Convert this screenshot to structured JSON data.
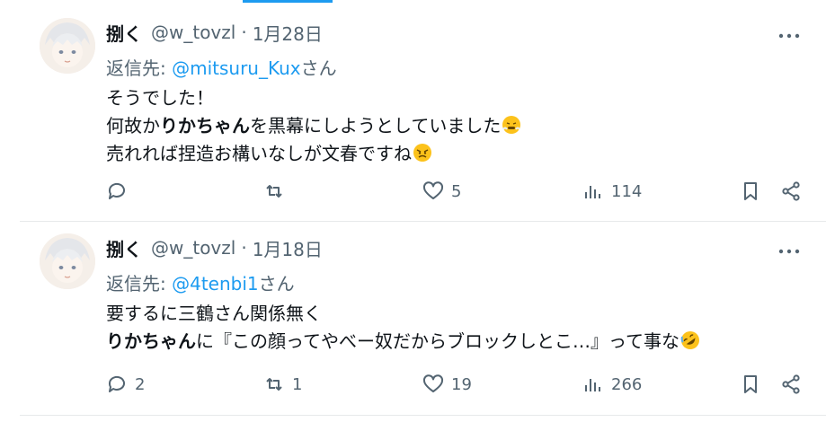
{
  "posts": [
    {
      "author": {
        "name": "捌く",
        "handle": "@w_tovzl",
        "date": "1月28日"
      },
      "reply_to": {
        "prefix": "返信先: ",
        "mention": "@mitsuru_Kux",
        "suffix": "さん"
      },
      "lines": [
        {
          "segments": [
            {
              "text": "そうでした！",
              "bold": false
            }
          ]
        },
        {
          "segments": [
            {
              "text": "何故か",
              "bold": false
            },
            {
              "text": "りかちゃん",
              "bold": true
            },
            {
              "text": "を黒幕にしようとしていました",
              "bold": false
            }
          ],
          "emoji": "triumph-face"
        },
        {
          "segments": [
            {
              "text": "売れれば捏造お構いなしが文春ですね",
              "bold": false
            }
          ],
          "emoji": "angry-face"
        }
      ],
      "stats": {
        "replies": "",
        "reposts": "",
        "likes": "5",
        "views": "114"
      }
    },
    {
      "author": {
        "name": "捌く",
        "handle": "@w_tovzl",
        "date": "1月18日"
      },
      "reply_to": {
        "prefix": "返信先: ",
        "mention": "@4tenbi1",
        "suffix": "さん"
      },
      "lines": [
        {
          "segments": [
            {
              "text": "要するに三鶴さん関係無く",
              "bold": false
            }
          ]
        },
        {
          "segments": [
            {
              "text": "りかちゃん",
              "bold": true
            },
            {
              "text": "に『この顔ってやべー奴だからブロックしとこ…』って事な",
              "bold": false
            }
          ],
          "emoji": "rolling-on-floor-laughing"
        }
      ],
      "stats": {
        "replies": "2",
        "reposts": "1",
        "likes": "19",
        "views": "266"
      }
    }
  ],
  "colors": {
    "accent": "#1d9bf0",
    "muted": "#536471",
    "text": "#0f1419"
  }
}
